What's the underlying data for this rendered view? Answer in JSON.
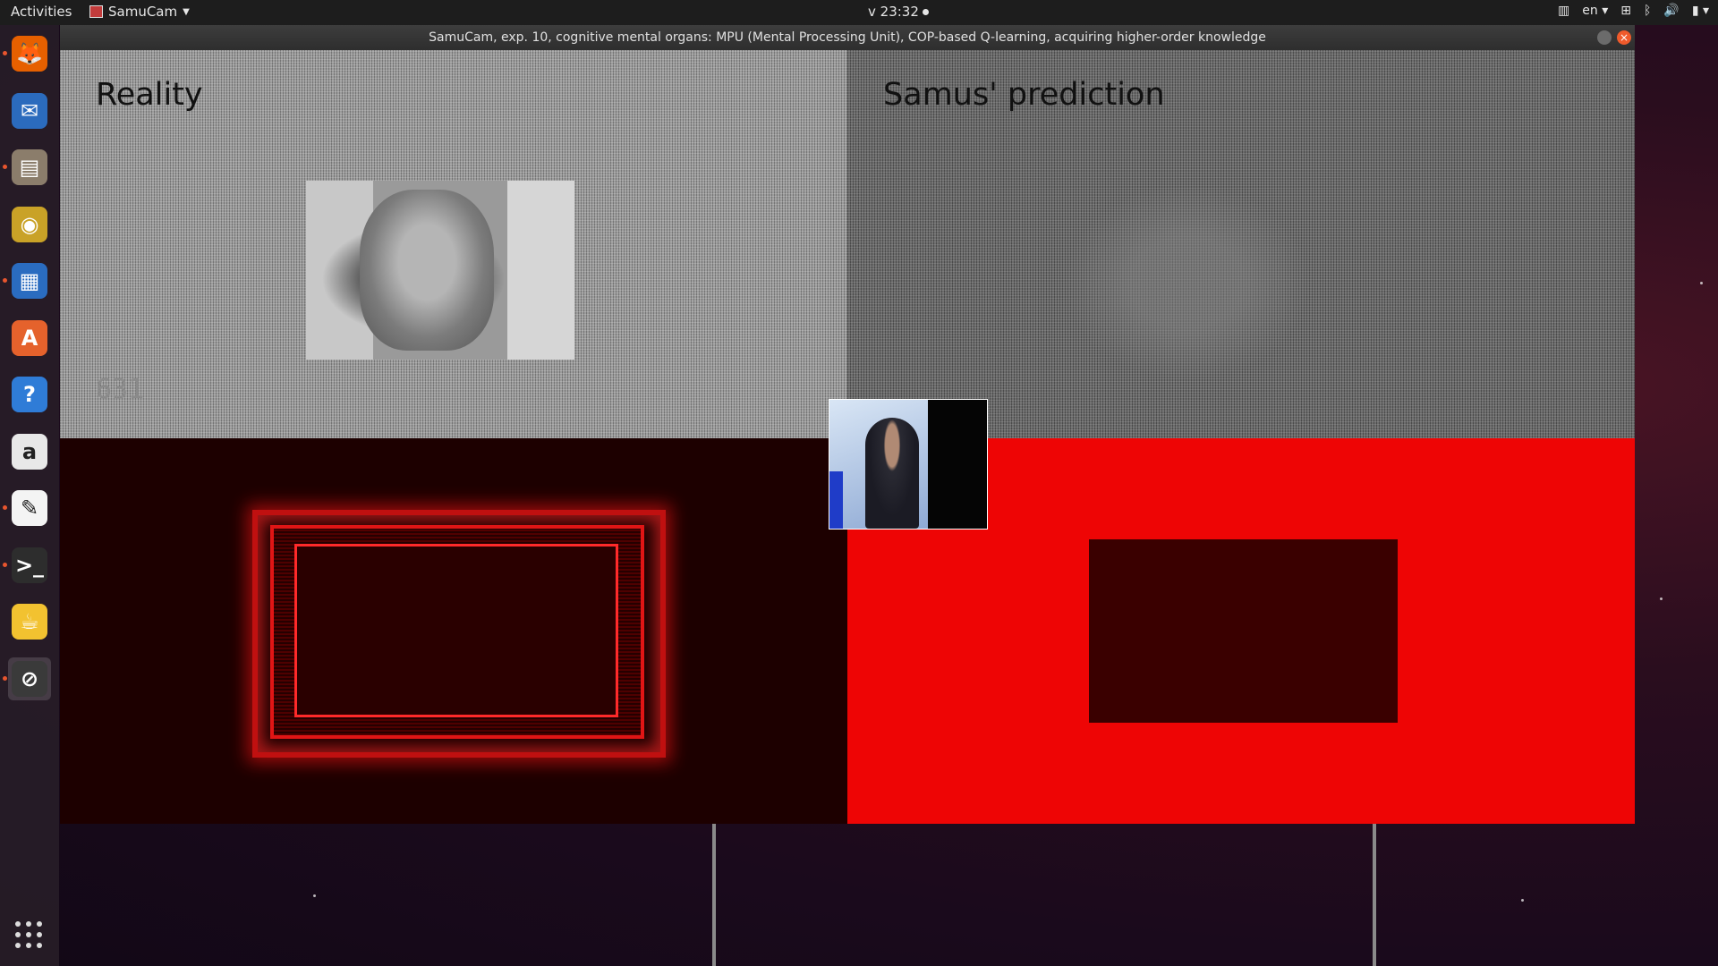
{
  "topbar": {
    "activities": "Activities",
    "app_menu": "SamuCam",
    "clock": "v 23:32",
    "language": "en"
  },
  "dock": {
    "items": [
      {
        "name": "firefox-icon",
        "glyph": "🦊",
        "color": "#e66000",
        "running": true
      },
      {
        "name": "thunderbird-icon",
        "glyph": "✉",
        "color": "#2b6bbd",
        "running": false
      },
      {
        "name": "files-icon",
        "glyph": "▤",
        "color": "#8b7d6b",
        "running": true
      },
      {
        "name": "rhythmbox-icon",
        "glyph": "◉",
        "color": "#c9a227",
        "running": false
      },
      {
        "name": "libreoffice-writer-icon",
        "glyph": "▦",
        "color": "#2a6cc0",
        "running": true
      },
      {
        "name": "software-center-icon",
        "glyph": "A",
        "color": "#e5622c",
        "running": false
      },
      {
        "name": "help-icon",
        "glyph": "?",
        "color": "#2f7cd7",
        "running": false
      },
      {
        "name": "amazon-icon",
        "glyph": "a",
        "color": "#e8e8e8",
        "running": false
      },
      {
        "name": "sketch-app-icon",
        "glyph": "✎",
        "color": "#f4f4f4",
        "running": true
      },
      {
        "name": "terminal-icon",
        "glyph": ">_",
        "color": "#2d2d2d",
        "running": true
      },
      {
        "name": "teapot-icon",
        "glyph": "☕",
        "color": "#f2c230",
        "running": false
      },
      {
        "name": "samucam-icon",
        "glyph": "⊘",
        "color": "#3a3a3a",
        "running": true
      }
    ]
  },
  "window": {
    "title": "SamuCam, exp. 10, cognitive mental organs: MPU (Mental Processing Unit), COP-based Q-learning, acquiring higher-order knowledge",
    "panes": {
      "reality_label": "Reality",
      "prediction_label": "Samus' prediction",
      "counter": "631"
    }
  }
}
